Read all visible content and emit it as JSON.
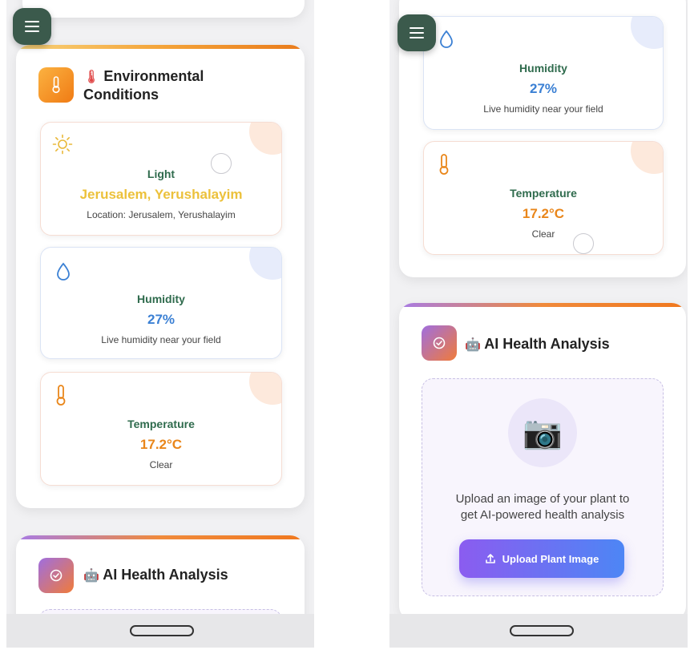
{
  "left_screen": {
    "env_panel": {
      "title_line1": "Environmental",
      "title_line2": "Conditions",
      "title_emoji": "🌡"
    },
    "light_card": {
      "label": "Light",
      "value": "Jerusalem, Yerushalayim",
      "sub": "Location: Jerusalem, Yerushalayim"
    },
    "humidity_card": {
      "label": "Humidity",
      "value": "27%",
      "sub": "Live humidity near your field"
    },
    "temperature_card": {
      "label": "Temperature",
      "value": "17.2°C",
      "sub": "Clear"
    },
    "ai_panel": {
      "title": "AI Health Analysis",
      "title_emoji": "🤖"
    }
  },
  "right_screen": {
    "humidity_card": {
      "label": "Humidity",
      "value": "27%",
      "sub": "Live humidity near your field"
    },
    "temperature_card": {
      "label": "Temperature",
      "value": "17.2°C",
      "sub": "Clear"
    },
    "ai_panel": {
      "title": "AI Health Analysis",
      "title_emoji": "🤖",
      "upload_text_line1": "Upload an image of your plant to",
      "upload_text_line2": "get AI-powered health analysis",
      "upload_button_label": "Upload Plant Image",
      "camera_emoji": "📷"
    }
  },
  "icons": {
    "menu": "menu-icon",
    "thermometer": "thermometer-icon",
    "sun": "sun-icon",
    "droplet": "droplet-icon",
    "check_circle": "check-circle-icon",
    "upload": "upload-icon"
  },
  "colors": {
    "menu_button": "#3b5a4c",
    "label_green": "#2f6b4d",
    "light_value": "#ecc13b",
    "humidity_value": "#3b80d4",
    "temperature_value": "#e9861a",
    "upload_button_start": "#8b5cf0",
    "upload_button_end": "#4d86f5"
  }
}
